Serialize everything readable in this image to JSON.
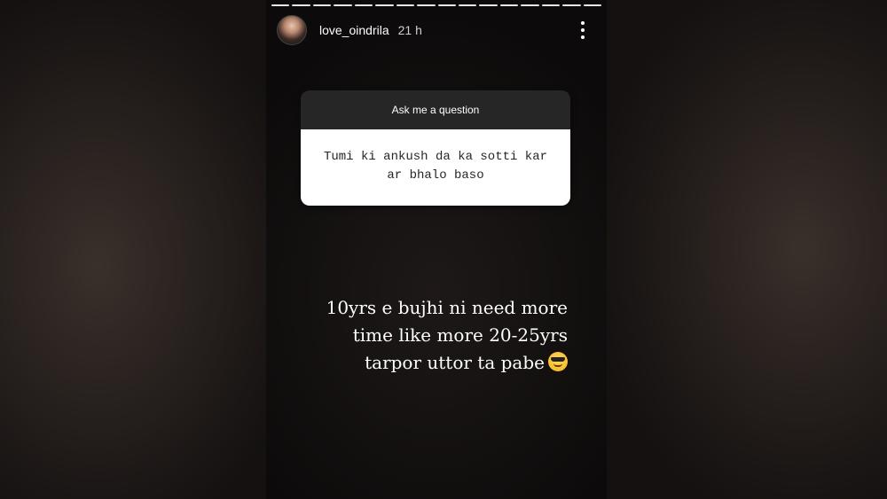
{
  "story": {
    "segments_total": 16,
    "username": "love_oindrila",
    "time_ago": "21 h",
    "more_icon": "more-vertical-icon",
    "question_sticker": {
      "title": "Ask me a question",
      "question_lines": [
        "Tumi ki ankush da ka sotti kar",
        "ar bhalo baso"
      ]
    },
    "answer_lines": [
      "10yrs e bujhi ni need more",
      "time like more 20-25yrs",
      "tarpor uttor ta pabe"
    ],
    "answer_emoji": "smiling-face-with-sunglasses-icon"
  }
}
